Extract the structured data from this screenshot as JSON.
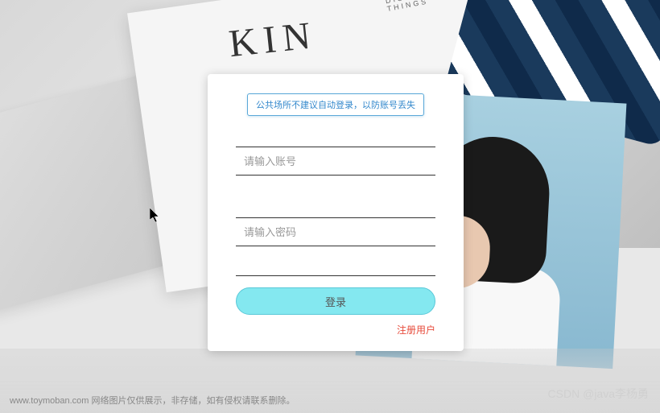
{
  "background": {
    "book_title": "KIN",
    "book_subtitle": "DISCOVERING NEW THINGS"
  },
  "login_form": {
    "warning_text": "公共场所不建议自动登录，以防账号丢失",
    "username_placeholder": "请输入账号",
    "username_value": "",
    "password_placeholder": "请输入密码",
    "password_value": "",
    "login_button_label": "登录",
    "register_link_label": "注册用户"
  },
  "watermarks": {
    "left": "www.toymoban.com 网络图片仅供展示，非存储，如有侵权请联系删除。",
    "right": "CSDN @java李杨勇"
  }
}
